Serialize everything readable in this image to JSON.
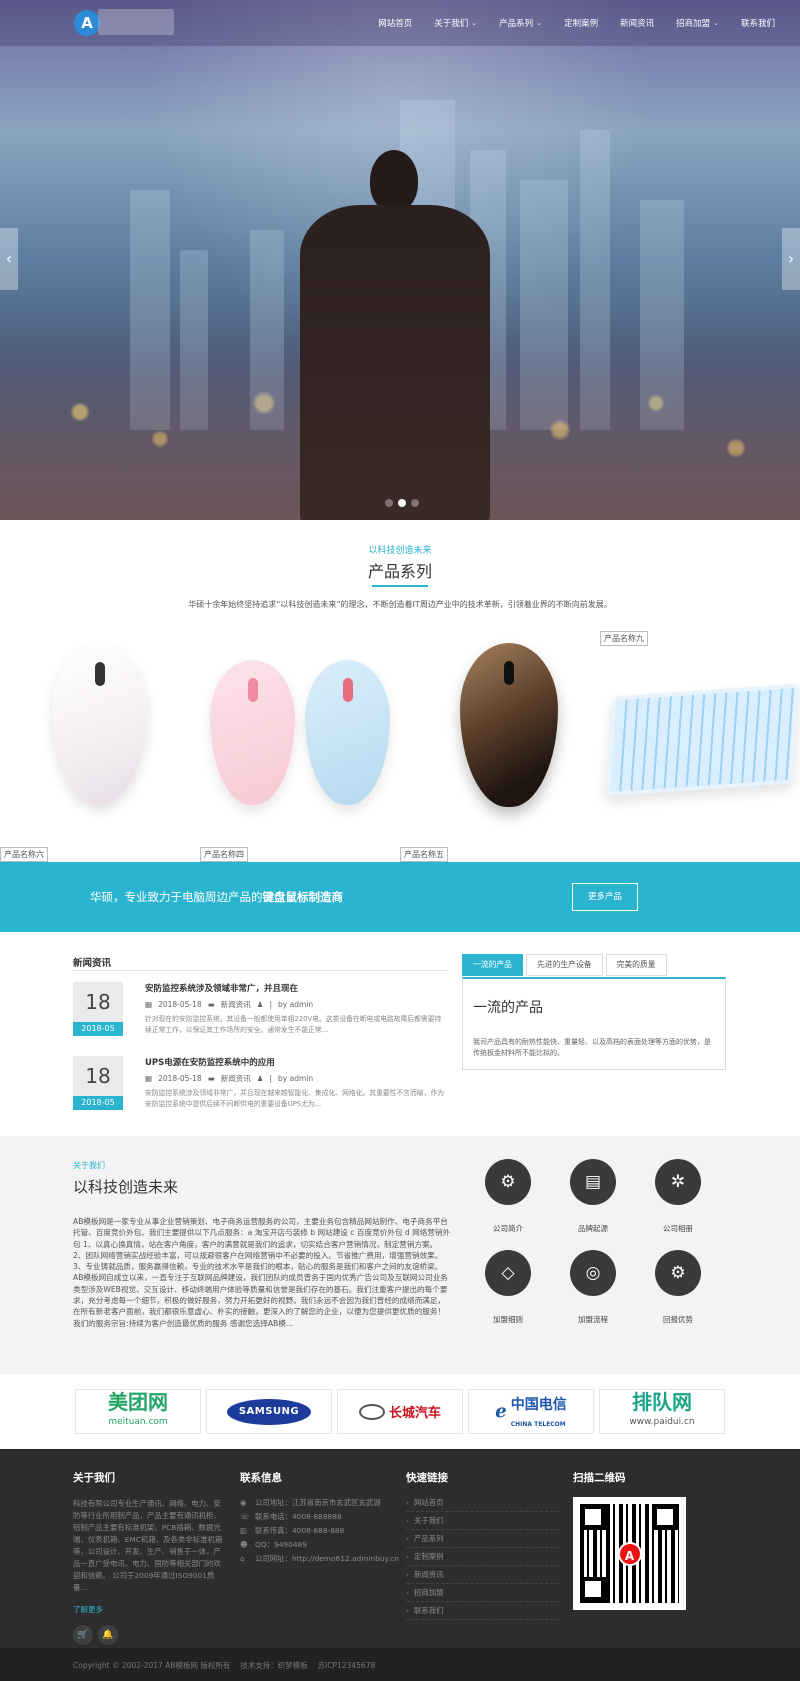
{
  "nav": {
    "items": [
      {
        "label": "网站首页",
        "has_dropdown": false
      },
      {
        "label": "关于我们",
        "has_dropdown": true
      },
      {
        "label": "产品系列",
        "has_dropdown": true
      },
      {
        "label": "定制案例",
        "has_dropdown": false
      },
      {
        "label": "新闻资讯",
        "has_dropdown": false
      },
      {
        "label": "招商加盟",
        "has_dropdown": true
      },
      {
        "label": "联系我们",
        "has_dropdown": false
      }
    ],
    "logo_letter": "A"
  },
  "hero": {
    "prev": "‹",
    "next": "›",
    "slide_count": 3,
    "active_slide": 2
  },
  "products": {
    "subtitle": "以科技创造未来",
    "title": "产品系列",
    "description": "华硕十余年始终坚持追求“以科技创造未来”的理念，不断创造着IT周边产业中的技术革新，引领着业界的不断向前发展。",
    "broken_images": {
      "p9": "产品名称九",
      "p6": "产品名称六",
      "p4": "产品名称四",
      "p5": "产品名称五"
    }
  },
  "cta": {
    "text_prefix": "华硕，专业致力于电脑周边产品的",
    "text_bold": "键盘鼠标制造商",
    "button": "更多产品"
  },
  "news": {
    "title": "新闻资讯",
    "items": [
      {
        "day": "18",
        "ym": "2018-05",
        "title": "安防监控系统涉及领域非常广，并且现在",
        "date": "2018-05-18",
        "category": "新闻资讯",
        "author": "by admin",
        "excerpt": "针对现在的安防监控系统，其设备一般都使用单相220V电。这类设备在断电或电路故障后都需要持续正常工作，以保证其工作场所的安全。通常发生不能正常..."
      },
      {
        "day": "18",
        "ym": "2018-05",
        "title": "UPS电源在安防监控系统中的应用",
        "date": "2018-05-18",
        "category": "新闻资讯",
        "author": "by admin",
        "excerpt": "安防监控系统涉及领域非常广，并且现在越来越智能化、集成化、网络化。其重要性不言而喻，作为安防监控系统中提供后续不间断供电的重要设备UPS尤为..."
      }
    ]
  },
  "tabs": {
    "items": [
      "一流的产品",
      "先进的生产设备",
      "完美的质量"
    ],
    "active": 0,
    "panel_title": "一流的产品",
    "panel_body": "我司产品具有的耐热性能快、重量轻、以及高档的表面处理等方面的优势，是传统板金材料所不能比拟的。"
  },
  "about": {
    "subtitle": "关于我们",
    "title": "以科技创造未来",
    "body": "AB模板网是一家专业从事企业营销策划、电子商务运营服务的公司，主要业务包含精品网站制作、电子商务平台托管、百度竞价外包、我们主要提供以下几点服务：a 淘宝开店与装修 b 网站建设 c 百度竞价外包 d 网络营销外包 1、以真心换真情，站在客户角度，客户的满意就是我们的追求，切实结合客户营销情况，制定营销方案。 2、团队网络营销实战经验丰富，可以规避很客户在网络营销中不必要的投入。节省推广费用，增强营销效果。 3、专业铸就品质，服务赢得信赖，专业的技术水平是我们的根本，贴心的服务是我们和客户之间的友谊桥梁。 AB模板网自成立以来，一直专注于互联网品牌建设，我们团队的成员曾务于国内优秀广告公司及互联网公司业务类型涉及WEB视觉、交互设计、移动终端用户体验等质量和信誉是我们存在的基石。我们注重客户提出的每个要求，充分考虑每一个细节，积极的做好服务，努力开拓更好的视野。我们永远不会因为我们曾经的成绩而满足，在所有新老客户面前，我们都很乐意虚心、朴实的接触，更深入的了解您的企业，以便为您提供更优质的服务！ 我们的服务宗旨:持续为客户创造最优质的服务 感谢您选择AB模...",
    "icons": [
      {
        "label": "公司简介",
        "icon": "gears-icon",
        "glyph": "⚙"
      },
      {
        "label": "品牌起源",
        "icon": "book-icon",
        "glyph": "▤"
      },
      {
        "label": "公司相册",
        "icon": "gear-icon",
        "glyph": "✲"
      },
      {
        "label": "加盟细则",
        "icon": "diamond-icon",
        "glyph": "◇"
      },
      {
        "label": "加盟流程",
        "icon": "target-icon",
        "glyph": "◎"
      },
      {
        "label": "回报优势",
        "icon": "gears-icon",
        "glyph": "⚙"
      }
    ]
  },
  "partners": [
    {
      "name": "美团网",
      "sub": "meituan.com"
    },
    {
      "name": "SAMSUNG",
      "sub": ""
    },
    {
      "name": "长城汽车",
      "sub": ""
    },
    {
      "name": "中国电信",
      "sub": "CHINA TELECOM"
    },
    {
      "name": "排队网",
      "sub": "www.paidui.cn"
    }
  ],
  "footer": {
    "about_title": "关于我们",
    "about_body": "科技有限公司专业生产通讯、网络、电力、安防等行业所用制产品，产品主要有通讯机柜、铝制产品主要有标准机架、PCB插箱、数据光端、仪表机箱、EMC机箱、及各类非标准机箱等，公司设计、开发、生产、销售于一体，产品一直广受电讯、电力、国防等相关部门的欢迎和信赖。 公司于2009年通过ISO9001质量...",
    "about_more": "了解更多",
    "contact_title": "联系信息",
    "contact": [
      {
        "icon": "location-icon",
        "glyph": "◉",
        "text": "公司地址：江苏省南京市玄武区玄武湖"
      },
      {
        "icon": "phone-icon",
        "glyph": "☏",
        "text": "联系电话：4008-888888"
      },
      {
        "icon": "fax-icon",
        "glyph": "▥",
        "text": "联系传真：4008-888-888"
      },
      {
        "icon": "qq-icon",
        "glyph": "☻",
        "text": "QQ：9490489"
      },
      {
        "icon": "home-icon",
        "glyph": "⌂",
        "text": "公司网址：http://demo612.adminbuy.cn"
      }
    ],
    "links_title": "快速链接",
    "links": [
      "网站首页",
      "关于我们",
      "产品系列",
      "定制案例",
      "新闻资讯",
      "招商加盟",
      "联系我们"
    ],
    "qr_title": "扫描二维码",
    "qr_logo": "A",
    "copyright": "Copyright © 2002-2017 AB模板网 版权所有　 技术支持：织梦模板　 苏ICP12345678"
  }
}
